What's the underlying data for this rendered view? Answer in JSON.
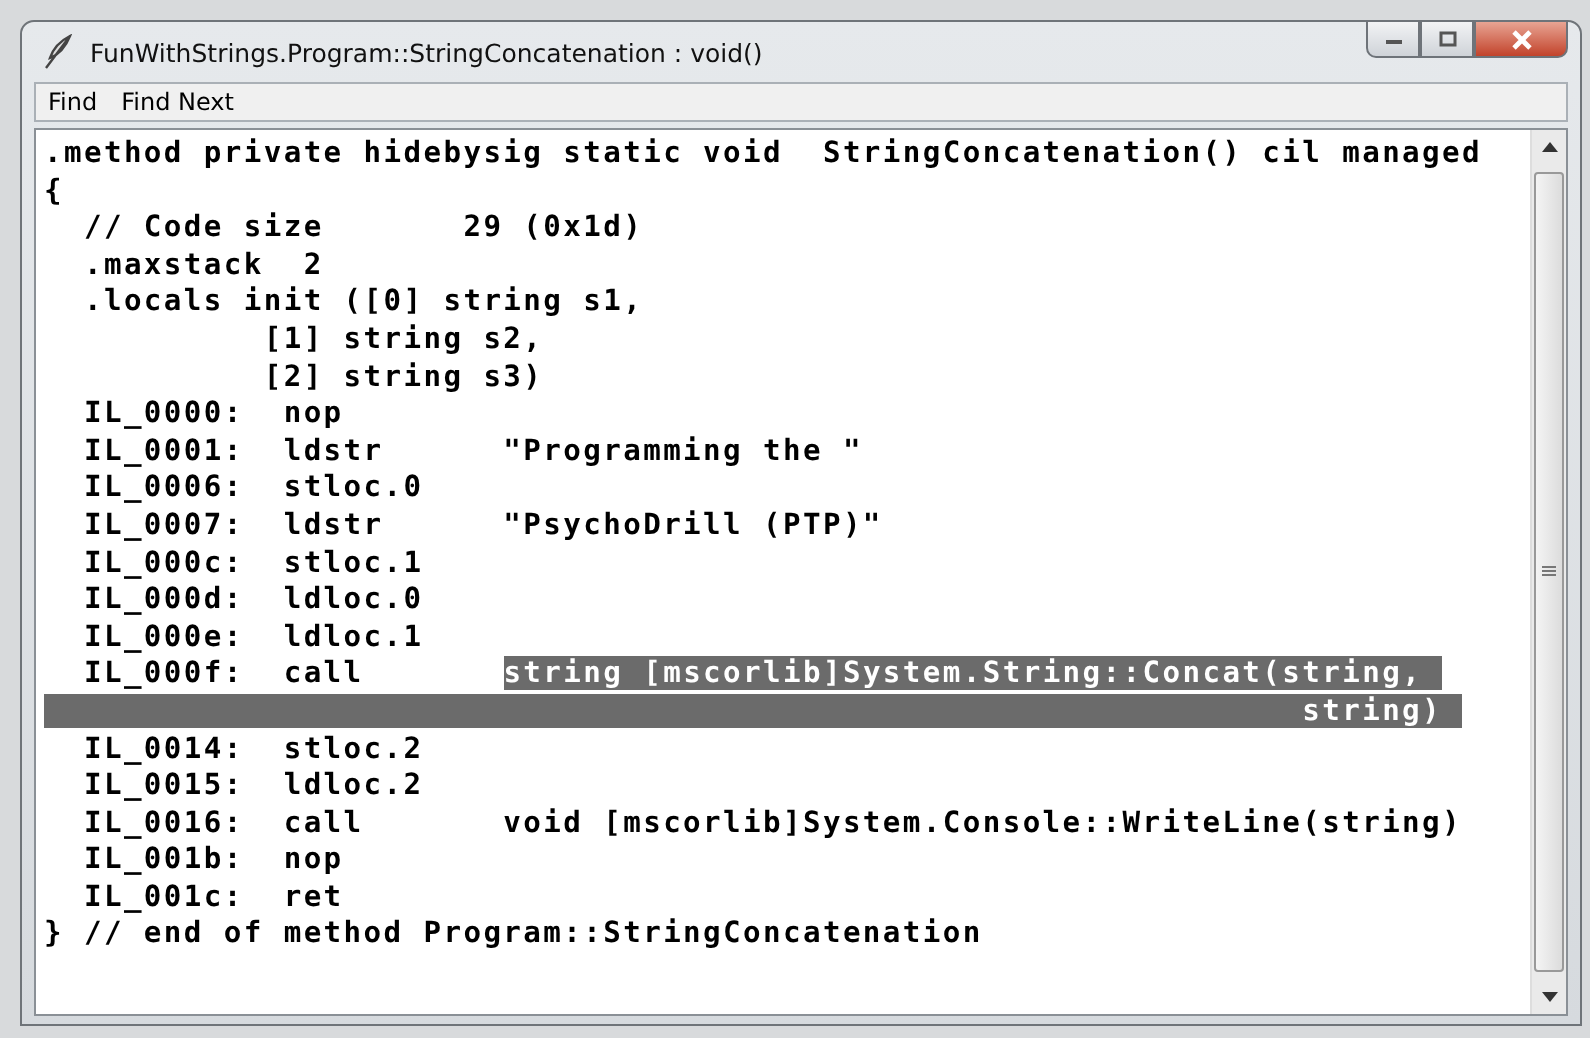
{
  "window": {
    "title": "FunWithStrings.Program::StringConcatenation : void()"
  },
  "menu": [
    {
      "label": "Find"
    },
    {
      "label": "Find Next"
    }
  ],
  "code_lines": [
    {
      "text": ".method private hidebysig static void  StringConcatenation() cil managed"
    },
    {
      "text": "{"
    },
    {
      "text": "  // Code size       29 (0x1d)"
    },
    {
      "text": "  .maxstack  2"
    },
    {
      "text": "  .locals init ([0] string s1,"
    },
    {
      "text": "           [1] string s2,"
    },
    {
      "text": "           [2] string s3)"
    },
    {
      "text": "  IL_0000:  nop"
    },
    {
      "text": "  IL_0001:  ldstr      \"Programming the \""
    },
    {
      "text": "  IL_0006:  stloc.0"
    },
    {
      "text": "  IL_0007:  ldstr      \"PsychoDrill (PTP)\""
    },
    {
      "text": "  IL_000c:  stloc.1"
    },
    {
      "text": "  IL_000d:  ldloc.0"
    },
    {
      "text": "  IL_000e:  ldloc.1"
    },
    {
      "text": "  IL_000f:  call       ",
      "highlight": "string [mscorlib]System.String::Concat(string, "
    },
    {
      "highlight": "                                                               string) "
    },
    {
      "text": "  IL_0014:  stloc.2"
    },
    {
      "text": "  IL_0015:  ldloc.2"
    },
    {
      "text": "  IL_0016:  call       void [mscorlib]System.Console::WriteLine(string)"
    },
    {
      "text": "  IL_001b:  nop"
    },
    {
      "text": "  IL_001c:  ret"
    },
    {
      "text": "} // end of method Program::StringConcatenation"
    }
  ]
}
